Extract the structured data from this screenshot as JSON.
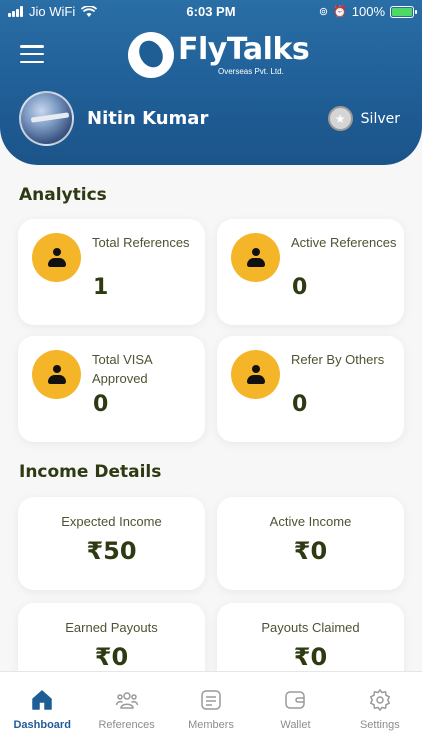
{
  "status_bar": {
    "carrier": "Jio WiFi",
    "time": "6:03 PM",
    "battery": "100%"
  },
  "header": {
    "brand": "FlyTalks",
    "brand_sub": "Overseas Pvt. Ltd.",
    "user_name": "Nitin Kumar",
    "tier": "Silver"
  },
  "analytics": {
    "title": "Analytics",
    "cards": [
      {
        "label": "Total References",
        "value": "1"
      },
      {
        "label": "Active References",
        "value": "0"
      },
      {
        "label": "Total VISA Approved",
        "value": "0"
      },
      {
        "label": "Refer By Others",
        "value": "0"
      }
    ]
  },
  "income": {
    "title": "Income Details",
    "cards": [
      {
        "label": "Expected Income",
        "value": "₹50"
      },
      {
        "label": "Active Income",
        "value": "₹0"
      },
      {
        "label": "Earned Payouts",
        "value": "₹0"
      },
      {
        "label": "Payouts Claimed",
        "value": "₹0"
      }
    ]
  },
  "tabs": [
    {
      "label": "Dashboard",
      "icon": "home-icon"
    },
    {
      "label": "References",
      "icon": "users-icon"
    },
    {
      "label": "Members",
      "icon": "members-icon"
    },
    {
      "label": "Wallet",
      "icon": "wallet-icon"
    },
    {
      "label": "Settings",
      "icon": "gear-icon"
    }
  ],
  "colors": {
    "header": "#1f5d95",
    "accent": "#f5b529",
    "active_tab": "#1f5d95"
  }
}
